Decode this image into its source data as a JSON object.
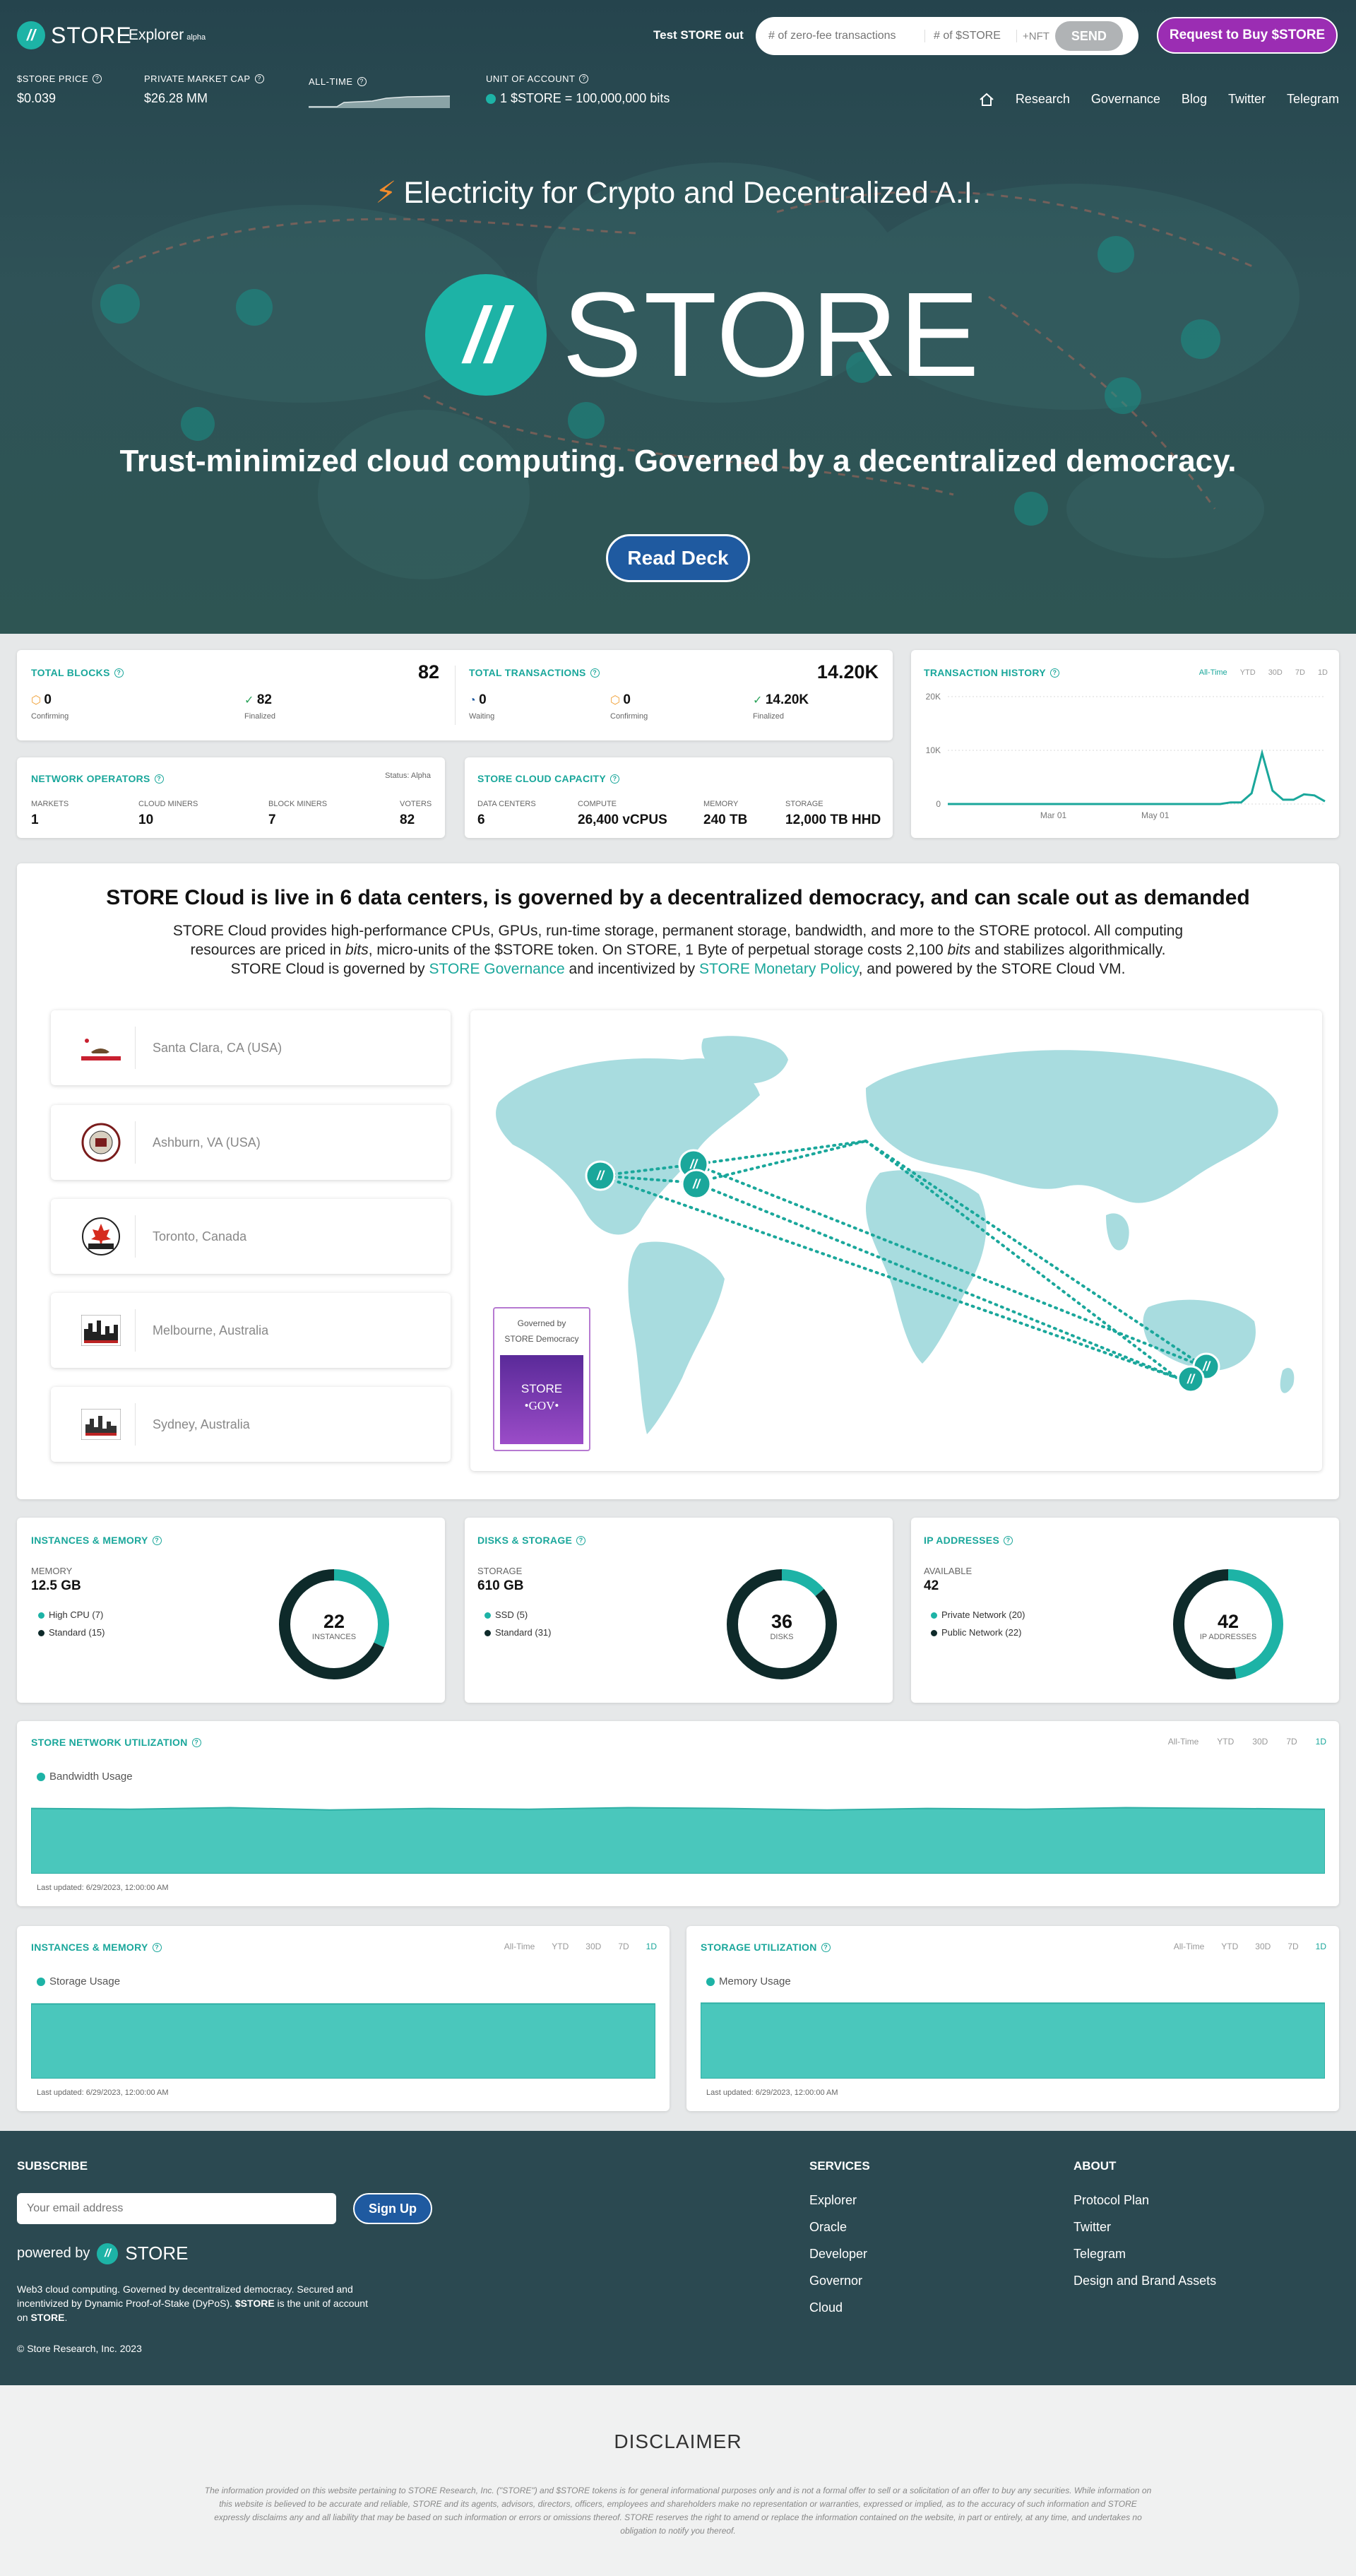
{
  "header": {
    "logo": "STORE",
    "explorer": "Explorer",
    "explorer_tag": "alpha",
    "test_label": "Test STORE out",
    "zero_fee_placeholder": "# of zero-fee transactions",
    "store_placeholder": "# of $STORE",
    "nft": "+NFT",
    "send": "SEND",
    "buy": "Request to Buy $STORE"
  },
  "stats": {
    "price_label": "$STORE PRICE",
    "price": "$0.039",
    "cap_label": "PRIVATE MARKET CAP",
    "cap": "$26.28 MM",
    "alltime_label": "ALL-TIME",
    "unit_label": "UNIT OF ACCOUNT",
    "unit": "1 $STORE = 100,000,000 bits"
  },
  "nav": [
    "Research",
    "Governance",
    "Blog",
    "Twitter",
    "Telegram"
  ],
  "hero": {
    "title": "Electricity for Crypto and Decentralized A.I.",
    "brand": "STORE",
    "tagline": "Trust-minimized cloud computing. Governed by a decentralized democracy.",
    "cta": "Read Deck"
  },
  "blocks": {
    "title": "TOTAL BLOCKS",
    "total": "82",
    "confirming": "0",
    "confirming_label": "Confirming",
    "finalized": "82",
    "finalized_label": "Finalized"
  },
  "transactions": {
    "title": "TOTAL TRANSACTIONS",
    "total": "14.20K",
    "waiting": "0",
    "waiting_label": "Waiting",
    "confirming": "0",
    "confirming_label": "Confirming",
    "finalized": "14.20K",
    "finalized_label": "Finalized"
  },
  "history": {
    "title": "TRANSACTION HISTORY",
    "ranges": [
      "All-Time",
      "YTD",
      "30D",
      "7D",
      "1D"
    ],
    "active": "All-Time"
  },
  "operators": {
    "title": "NETWORK OPERATORS",
    "status": "Status: Alpha",
    "cols": [
      {
        "label": "MARKETS",
        "value": "1"
      },
      {
        "label": "CLOUD MINERS",
        "value": "10"
      },
      {
        "label": "BLOCK MINERS",
        "value": "7"
      },
      {
        "label": "VOTERS",
        "value": "82"
      }
    ]
  },
  "capacity": {
    "title": "STORE CLOUD CAPACITY",
    "cols": [
      {
        "label": "DATA CENTERS",
        "value": "6"
      },
      {
        "label": "COMPUTE",
        "value": "26,400 vCPUS"
      },
      {
        "label": "MEMORY",
        "value": "240 TB"
      },
      {
        "label": "STORAGE",
        "value": "12,000 TB HHD"
      }
    ]
  },
  "cloud": {
    "heading": "STORE Cloud is live in 6 data centers, is governed by a decentralized democracy, and can scale out as demanded",
    "p1": "STORE Cloud provides high-performance CPUs, GPUs, run-time storage, permanent storage, bandwidth, and more to the STORE protocol. All computing",
    "p2a": "resources are priced in ",
    "p2b": "bits",
    "p2c": ", micro-units of the $STORE token. On STORE, 1 Byte of perpetual storage costs 2,100 ",
    "p2d": "bits",
    "p2e": " and stabilizes algorithmically.",
    "p3a": "STORE Cloud is governed by ",
    "p3b": "STORE Governance",
    "p3c": " and incentivized by ",
    "p3d": "STORE Monetary Policy",
    "p3e": ", and powered by the STORE Cloud VM.",
    "locations": [
      "Santa Clara, CA (USA)",
      "Ashburn, VA (USA)",
      "Toronto, Canada",
      "Melbourne, Australia",
      "Sydney, Australia"
    ],
    "gov_label": "Governed by STORE Democracy",
    "gov_badge": "STORE",
    "gov_sub": "•GOV•"
  },
  "instances": {
    "title": "INSTANCES & MEMORY",
    "mem_label": "MEMORY",
    "mem": "12.5 GB",
    "legend": [
      "High CPU (7)",
      "Standard (15)"
    ],
    "count": "22",
    "count_label": "INSTANCES"
  },
  "disks": {
    "title": "DISKS & STORAGE",
    "label": "STORAGE",
    "value": "610 GB",
    "legend": [
      "SSD (5)",
      "Standard (31)"
    ],
    "count": "36",
    "count_label": "DISKS"
  },
  "ips": {
    "title": "IP ADDRESSES",
    "label": "AVAILABLE",
    "value": "42",
    "legend": [
      "Private Network (20)",
      "Public Network (22)"
    ],
    "count": "42",
    "count_label": "IP ADDRESSES"
  },
  "network_util": {
    "title": "STORE NETWORK UTILIZATION",
    "legend": "Bandwidth Usage",
    "updated": "Last updated: 6/29/2023, 12:00:00 AM",
    "ranges": [
      "All-Time",
      "YTD",
      "30D",
      "7D",
      "1D"
    ],
    "active": "1D"
  },
  "inst_util": {
    "title": "INSTANCES & MEMORY",
    "legend": "Storage Usage",
    "updated": "Last updated: 6/29/2023, 12:00:00 AM",
    "ranges": [
      "All-Time",
      "YTD",
      "30D",
      "7D",
      "1D"
    ],
    "active": "1D"
  },
  "storage_util": {
    "title": "STORAGE UTILIZATION",
    "legend": "Memory Usage",
    "updated": "Last updated: 6/29/2023, 12:00:00 AM",
    "ranges": [
      "All-Time",
      "YTD",
      "30D",
      "7D",
      "1D"
    ],
    "active": "1D"
  },
  "footer": {
    "subscribe": "SUBSCRIBE",
    "email_placeholder": "Your email address",
    "signup": "Sign Up",
    "powered": "powered by",
    "brand": "STORE",
    "desc1": "Web3 cloud computing. Governed by decentralized democracy. Secured and",
    "desc2": "incentivized by Dynamic Proof-of-Stake (DyPoS). ",
    "desc2b": "$STORE",
    "desc2c": " is the unit of account",
    "desc3a": "on ",
    "desc3b": "STORE",
    "desc3c": ".",
    "copyright": "© Store Research, Inc. 2023",
    "services_title": "SERVICES",
    "services": [
      "Explorer",
      "Oracle",
      "Developer",
      "Governor",
      "Cloud"
    ],
    "about_title": "ABOUT",
    "about": [
      "Protocol Plan",
      "Twitter",
      "Telegram",
      "Design and Brand Assets"
    ]
  },
  "disclaimer": {
    "title": "DISCLAIMER",
    "l1": "The information provided on this website pertaining to STORE Research, Inc. (\"STORE\") and $STORE tokens is for general informational purposes only and is not a formal offer to sell or a solicitation of an offer to buy any securities. While information on",
    "l2": "this website is believed to be accurate and reliable, STORE and its agents, advisors, directors, officers, employees and shareholders make no representation or warranties, expressed or implied, as to the accuracy of such information and STORE",
    "l3": "expressly disclaims any and all liability that may be based on such information or errors or omissions thereof. STORE reserves the right to amend or replace the information contained on the website, in part or entirely, at any time, and undertakes no",
    "l4": "obligation to notify you thereof."
  },
  "colors": {
    "teal": "#1db3a6",
    "dark": "#2b4951",
    "purple": "#9b2db3",
    "navy": "#1f5aa0"
  },
  "chart_data": [
    {
      "type": "line",
      "title": "TRANSACTION HISTORY",
      "x_ticks": [
        "Mar 01",
        "May 01"
      ],
      "y_ticks": [
        "0",
        "10K",
        "20K"
      ],
      "ylim": [
        0,
        20000
      ],
      "values": [
        0,
        0,
        0,
        0,
        0,
        0,
        0,
        0,
        0,
        0,
        0,
        0,
        0,
        0,
        0,
        0,
        0,
        0,
        0,
        0,
        0,
        0,
        0,
        0,
        0,
        0,
        0,
        300,
        300,
        2000,
        9500,
        2500,
        800,
        800,
        1800,
        1600,
        500
      ]
    },
    {
      "type": "area",
      "title": "STORE NETWORK UTILIZATION",
      "series": [
        {
          "name": "Bandwidth Usage",
          "values": [
            0.84,
            0.83,
            0.85,
            0.82,
            0.84,
            0.83,
            0.85,
            0.84,
            0.82,
            0.84,
            0.83,
            0.85,
            0.84,
            0.83
          ]
        }
      ]
    },
    {
      "type": "area",
      "title": "INSTANCES & MEMORY",
      "series": [
        {
          "name": "Storage Usage",
          "values": [
            0.96,
            0.96,
            0.96,
            0.96,
            0.96,
            0.96,
            0.96,
            0.96
          ]
        }
      ]
    },
    {
      "type": "area",
      "title": "STORAGE UTILIZATION",
      "series": [
        {
          "name": "Memory Usage",
          "values": [
            0.97,
            0.97,
            0.97,
            0.97,
            0.97,
            0.97,
            0.97,
            0.97
          ]
        }
      ]
    }
  ],
  "donuts": {
    "instances": [
      7,
      15
    ],
    "disks": [
      5,
      31
    ],
    "ips": [
      20,
      22
    ]
  }
}
